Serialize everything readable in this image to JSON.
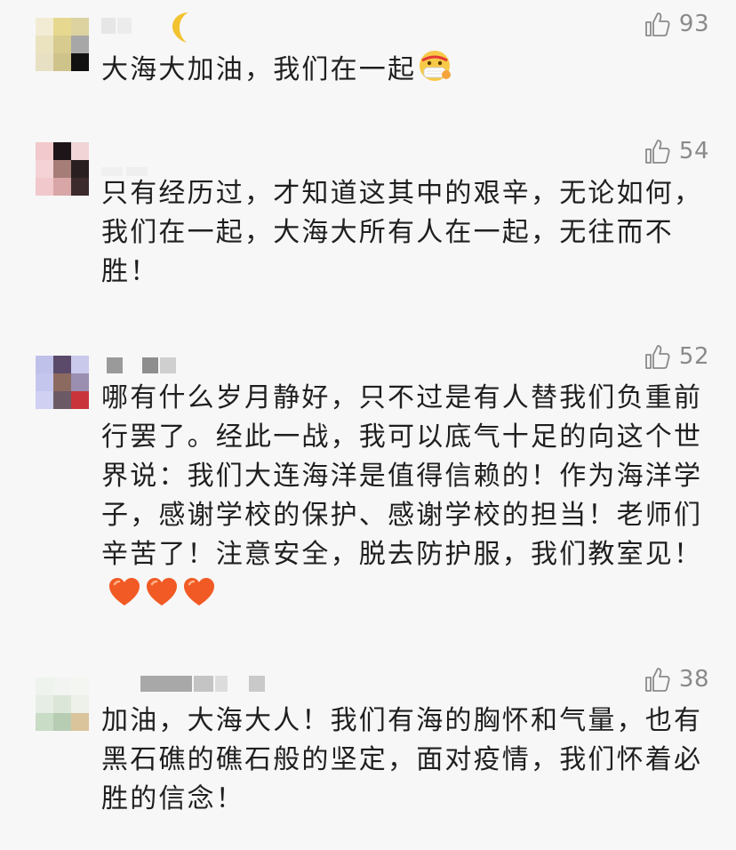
{
  "comments": [
    {
      "text": "大海大加油，我们在一起",
      "emoji": "mask-face-emoji",
      "likes": "93"
    },
    {
      "text": "只有经历过，才知道这其中的艰辛，无论如何，我们在一起，大海大所有人在一起，无往而不胜！",
      "likes": "54"
    },
    {
      "text": "哪有什么岁月静好，只不过是有人替我们负重前行罢了。经此一战，我可以底气十足的向这个世界说：我们大连海洋是值得信赖的！作为海洋学子，感谢学校的保护、感谢学校的担当！老师们辛苦了！注意安全，脱去防护服，我们教室见！",
      "emoji": "orange-heart-emoji x3",
      "likes": "52"
    },
    {
      "text": "加油，大海大人！我们有海的胸怀和气量，也有黑石礁的礁石般的坚定，面对疫情，我们怀着必胜的信念！",
      "likes": "38"
    }
  ],
  "colors": {
    "background": "#f7f7f7",
    "text": "#1f1f1f",
    "like": "#8a8a8a",
    "heart": "#f15a24"
  }
}
